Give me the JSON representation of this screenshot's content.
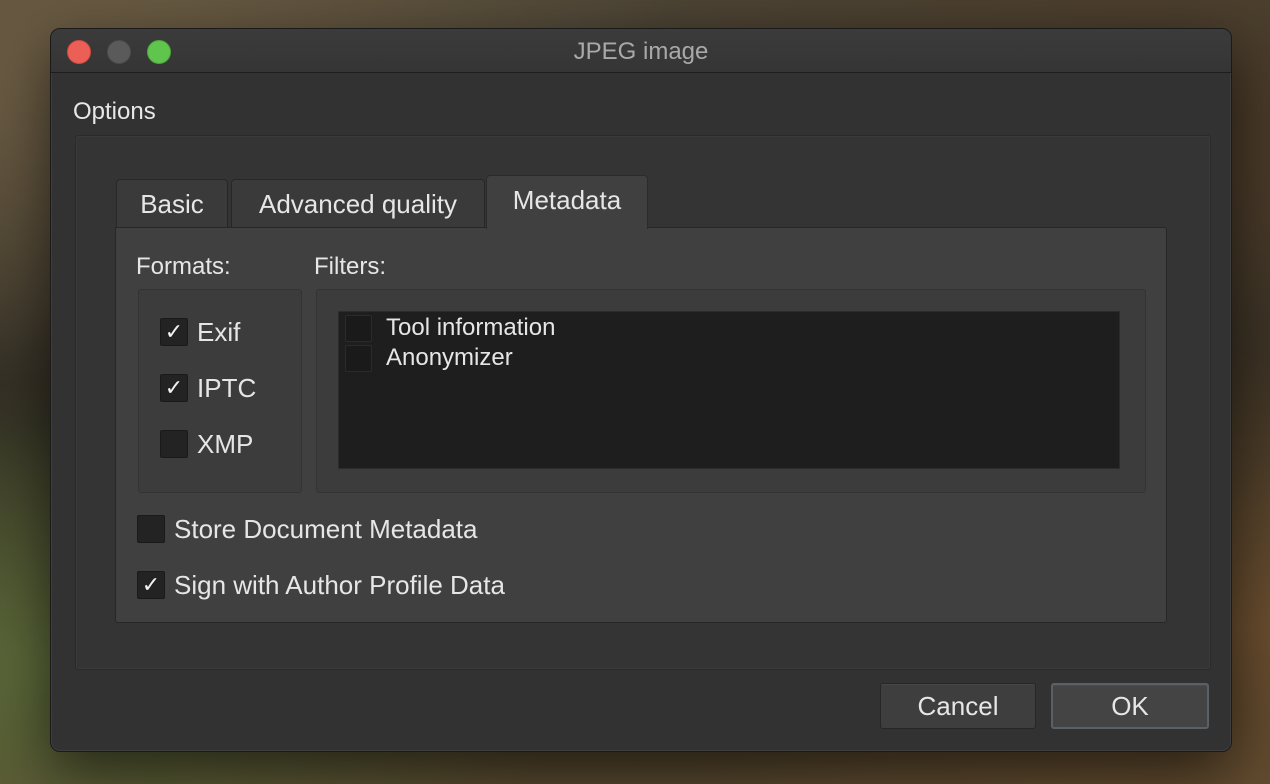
{
  "window": {
    "title": "JPEG image"
  },
  "options": {
    "label": "Options"
  },
  "tabs": [
    {
      "label": "Basic",
      "active": false
    },
    {
      "label": "Advanced quality",
      "active": false
    },
    {
      "label": "Metadata",
      "active": true
    }
  ],
  "metadata": {
    "formats_label": "Formats:",
    "filters_label": "Filters:",
    "formats": [
      {
        "label": "Exif",
        "checked": true,
        "check": "✓"
      },
      {
        "label": "IPTC",
        "checked": true,
        "check": "✓"
      },
      {
        "label": "XMP",
        "checked": false,
        "check": ""
      }
    ],
    "filters": [
      {
        "label": "Tool information",
        "checked": false
      },
      {
        "label": "Anonymizer",
        "checked": false
      }
    ],
    "store_document_metadata": {
      "label": "Store Document Metadata",
      "checked": false,
      "check": ""
    },
    "sign_author_profile": {
      "label": "Sign with Author Profile Data",
      "checked": true,
      "check": "✓"
    }
  },
  "buttons": {
    "cancel": "Cancel",
    "ok": "OK"
  },
  "colors": {
    "close": "#ec5f57",
    "minimize": "#5a5a5a",
    "maximize": "#5fc54d",
    "window_bg": "#323232",
    "panel_bg": "#404040"
  }
}
